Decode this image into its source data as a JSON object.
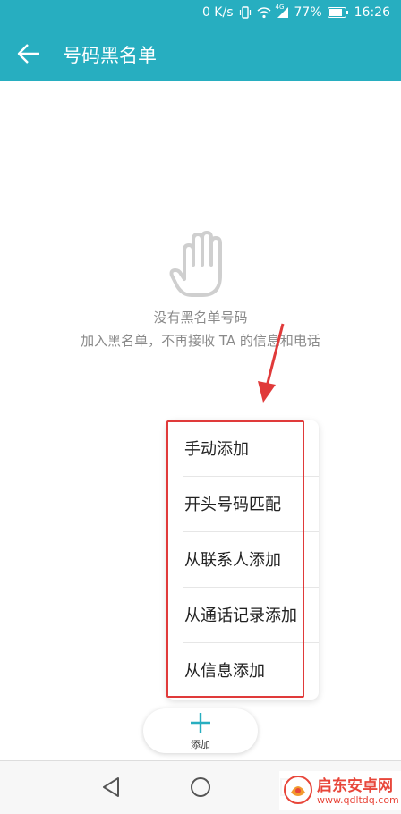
{
  "status_bar": {
    "net_speed": "0 K/s",
    "network": "4G",
    "battery": "77%",
    "time": "16:26"
  },
  "app_bar": {
    "title": "号码黑名单"
  },
  "empty_state": {
    "title": "没有黑名单号码",
    "subtitle": "加入黑名单，不再接收 TA 的信息和电话"
  },
  "add_menu": {
    "items": [
      {
        "label": "手动添加"
      },
      {
        "label": "开头号码匹配"
      },
      {
        "label": "从联系人添加"
      },
      {
        "label": "从通话记录添加"
      },
      {
        "label": "从信息添加"
      }
    ]
  },
  "add_button": {
    "label": "添加"
  },
  "watermark": {
    "name": "启东安卓网",
    "url": "www.qdltdq.com"
  },
  "colors": {
    "accent": "#27aec0",
    "highlight": "#e03a3a",
    "watermark": "#e8463a"
  }
}
